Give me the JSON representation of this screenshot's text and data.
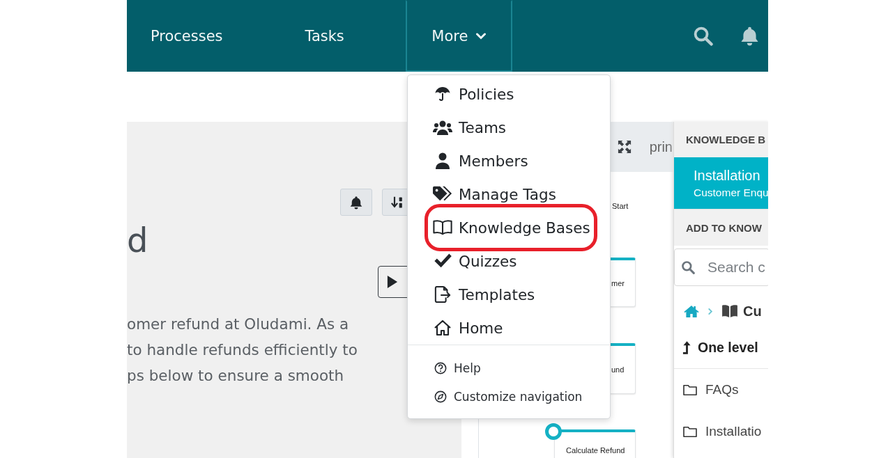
{
  "navbar": {
    "items": [
      {
        "label": "Processes",
        "kind": "link",
        "selected": false
      },
      {
        "label": "Tasks",
        "kind": "link",
        "selected": false
      },
      {
        "label": "More",
        "kind": "dropdown",
        "selected": true
      }
    ]
  },
  "more_menu": {
    "items": [
      {
        "label": "Policies",
        "highlighted": false
      },
      {
        "label": "Teams",
        "highlighted": false
      },
      {
        "label": "Members",
        "highlighted": false
      },
      {
        "label": "Manage Tags",
        "highlighted": false
      },
      {
        "label": "Knowledge Bases",
        "highlighted": true
      },
      {
        "label": "Quizzes",
        "highlighted": false
      },
      {
        "label": "Templates",
        "highlighted": false
      },
      {
        "label": "Home",
        "highlighted": false
      }
    ],
    "footer_items": [
      {
        "label": "Help"
      },
      {
        "label": "Customize navigation"
      }
    ]
  },
  "process": {
    "heading": "d",
    "description_lines": [
      "omer refund at Oludami. As a",
      "to handle refunds efficiently to",
      "ps below to ensure a smooth"
    ],
    "diagram_header": "prin",
    "nodes": [
      {
        "kind": "start",
        "label": "Start"
      },
      {
        "kind": "step",
        "label": "mer"
      },
      {
        "kind": "step",
        "label": "und"
      },
      {
        "kind": "step",
        "label": "Calculate Refund",
        "handle": true
      }
    ]
  },
  "knowledge_panel": {
    "header": "KNOWLEDGE B",
    "selected_item": {
      "title": "Installation",
      "subtitle": "Customer Enqu"
    },
    "add_header": "ADD TO KNOW",
    "search": {
      "placeholder": "Search c"
    },
    "breadcrumb": [
      {
        "kind": "home"
      },
      {
        "kind": "book",
        "label": "Cu"
      }
    ],
    "up_link": "One level",
    "folders": [
      "FAQs",
      "Installatio"
    ]
  }
}
